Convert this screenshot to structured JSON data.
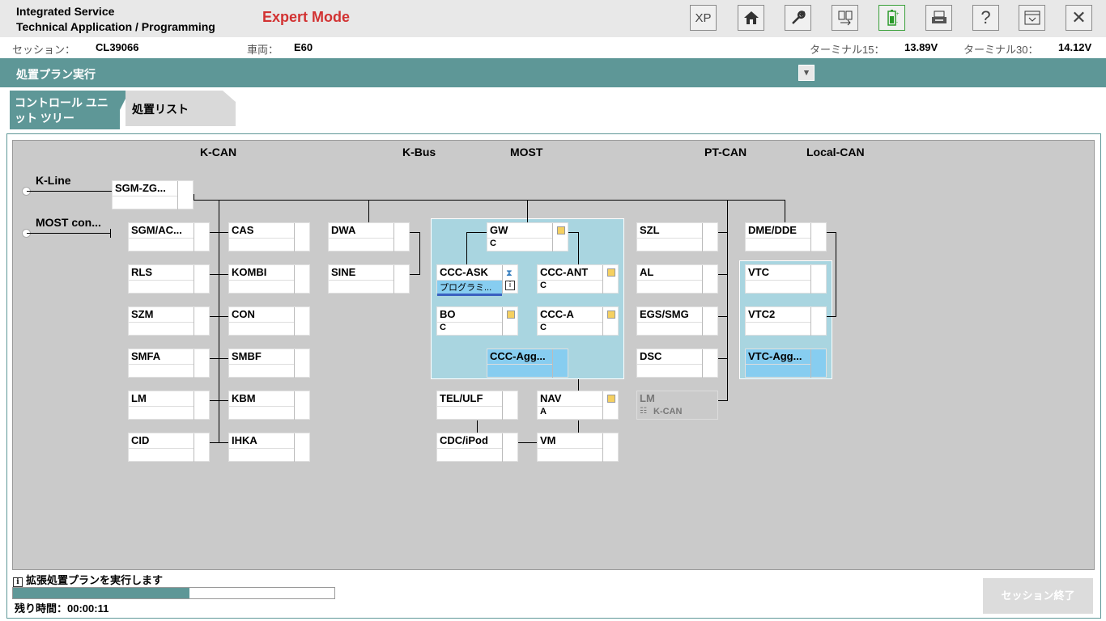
{
  "app": {
    "title_line1": "Integrated Service",
    "title_line2": "Technical Application / Programming",
    "mode": "Expert Mode"
  },
  "toolbar": [
    {
      "icon": "xp-icon",
      "label": "XP"
    },
    {
      "icon": "home-icon",
      "label": "⌂"
    },
    {
      "icon": "wrench-icon",
      "label": "🔧"
    },
    {
      "icon": "swap-icon",
      "label": "⇄"
    },
    {
      "icon": "battery-icon",
      "label": "▮"
    },
    {
      "icon": "print-icon",
      "label": "⎙"
    },
    {
      "icon": "help-icon",
      "label": "?"
    },
    {
      "icon": "collapse-icon",
      "label": "▾"
    },
    {
      "icon": "close-icon",
      "label": "✕"
    }
  ],
  "session": {
    "session_label": "セッション：",
    "session_value": "CL39066",
    "vehicle_label": "車両：",
    "vehicle_value": "E60",
    "t15_label": "ターミナル15：",
    "t15_value": "13.89V",
    "t30_label": "ターミナル30：",
    "t30_value": "14.12V"
  },
  "header": {
    "title": "処置プラン実行"
  },
  "tabs": {
    "tab1": "コントロール ユニット ツリー",
    "tab2": "処置リスト"
  },
  "buses": {
    "kcan": "K-CAN",
    "kbus": "K-Bus",
    "most": "MOST",
    "ptcan": "PT-CAN",
    "localcan": "Local-CAN"
  },
  "side": {
    "kline": "K-Line",
    "most_con": "MOST con..."
  },
  "ecus": {
    "sgmzg": {
      "name": "SGM-ZG...",
      "sub": ""
    },
    "sgmac": {
      "name": "SGM/AC...",
      "sub": ""
    },
    "rls": {
      "name": "RLS",
      "sub": ""
    },
    "szm": {
      "name": "SZM",
      "sub": ""
    },
    "smfa": {
      "name": "SMFA",
      "sub": ""
    },
    "lm1": {
      "name": "LM",
      "sub": ""
    },
    "cid": {
      "name": "CID",
      "sub": ""
    },
    "cas": {
      "name": "CAS",
      "sub": ""
    },
    "kombi": {
      "name": "KOMBI",
      "sub": ""
    },
    "con": {
      "name": "CON",
      "sub": ""
    },
    "smbf": {
      "name": "SMBF",
      "sub": ""
    },
    "kbm": {
      "name": "KBM",
      "sub": ""
    },
    "ihka": {
      "name": "IHKA",
      "sub": ""
    },
    "dwa": {
      "name": "DWA",
      "sub": ""
    },
    "sine": {
      "name": "SINE",
      "sub": ""
    },
    "gw": {
      "name": "GW",
      "sub": "C"
    },
    "cccask": {
      "name": "CCC-ASK",
      "sub": "プログラミ..."
    },
    "cccant": {
      "name": "CCC-ANT",
      "sub": "C"
    },
    "bo": {
      "name": "BO",
      "sub": "C"
    },
    "ccca": {
      "name": "CCC-A",
      "sub": "C"
    },
    "cccagg": {
      "name": "CCC-Agg...",
      "sub": ""
    },
    "telulf": {
      "name": "TEL/ULF",
      "sub": ""
    },
    "nav": {
      "name": "NAV",
      "sub": "A"
    },
    "cdcipod": {
      "name": "CDC/iPod",
      "sub": ""
    },
    "vm": {
      "name": "VM",
      "sub": ""
    },
    "szl": {
      "name": "SZL",
      "sub": ""
    },
    "al": {
      "name": "AL",
      "sub": ""
    },
    "egssmg": {
      "name": "EGS/SMG",
      "sub": ""
    },
    "dsc": {
      "name": "DSC",
      "sub": ""
    },
    "lm2": {
      "name": "LM",
      "sub": "K-CAN"
    },
    "dmedde": {
      "name": "DME/DDE",
      "sub": ""
    },
    "vtc": {
      "name": "VTC",
      "sub": ""
    },
    "vtc2": {
      "name": "VTC2",
      "sub": ""
    },
    "vtcagg": {
      "name": "VTC-Agg...",
      "sub": ""
    }
  },
  "status": {
    "message": "拡張処置プランを実行します",
    "remaining": "残り時間：00:00:11",
    "progress": 0.55
  },
  "end_button": "セッション終了"
}
